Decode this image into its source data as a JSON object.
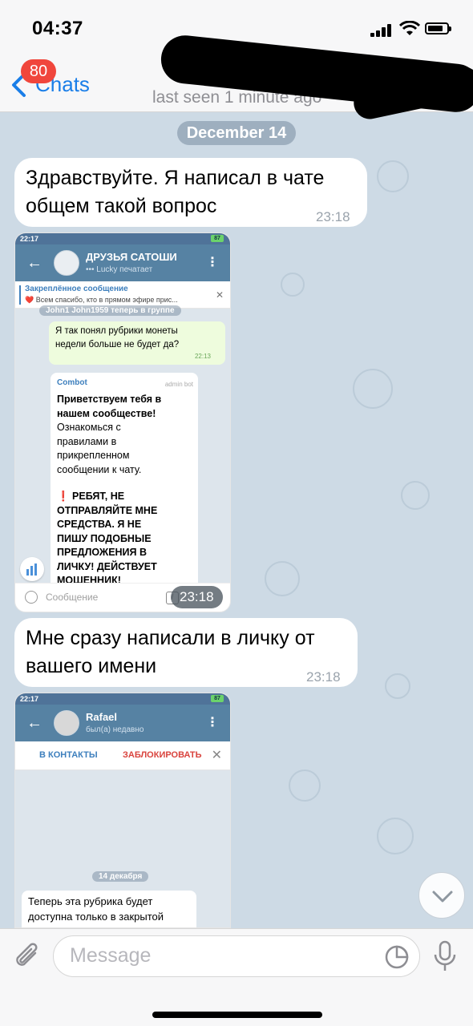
{
  "status_bar": {
    "time": "04:37",
    "battery": "battery-icon",
    "signal": "signal-icon",
    "wifi": "wifi-icon"
  },
  "header": {
    "back_label": "Chats",
    "unread_count": "80",
    "last_seen": "last seen 1 minute ago"
  },
  "date_pill": "December 14",
  "messages": [
    {
      "text_line1": "Здравствуйте.  Я написал в чате",
      "text_line2": "общем  такой  вопрос",
      "time": "23:18"
    },
    {
      "text_line1": "Мне сразу написали в личку от",
      "text_line2": "вашего  имени",
      "time": "23:18"
    }
  ],
  "screenshot1": {
    "status_time": "22:17",
    "battery": "87",
    "group_title": "ДРУЗЬЯ САТОШИ",
    "group_status": "Lucky печатает",
    "pinned_title": "Закреплённое сообщение",
    "pinned_text": "Всем спасибо, кто в прямом эфире прис...",
    "system_msg": "John1 John1959 теперь в группе",
    "question_line1": "Я так понял рубрики монеты",
    "question_line2": "недели больше не будет  да?",
    "question_time": "22:13",
    "bot_name": "Combot",
    "bot_role": "admin bot",
    "bot_lines_bold": [
      "Приветствуем тебя в",
      "нашем сообществе!"
    ],
    "bot_lines": [
      "Ознакомься с",
      "правилами в",
      "прикрепленном",
      "сообщении к чату."
    ],
    "bot_warning": [
      "❗ РЕБЯТ, НЕ",
      "ОТПРАВЛЯЙТЕ МНЕ",
      "СРЕДСТВА. Я НЕ",
      "ПИШУ ПОДОБНЫЕ",
      "ПРЕДЛОЖЕНИЯ В",
      "ЛИЧКУ! ДЕЙСТВУЕТ",
      "МОШЕННИК!"
    ],
    "input_placeholder": "Сообщение",
    "time_overlay": "23:18"
  },
  "screenshot2": {
    "status_time": "22:17",
    "contact_name": "Rafael",
    "contact_status": "был(а) недавно",
    "add_contact": "В КОНТАКТЫ",
    "block": "ЗАБЛОКИРОВАТЬ",
    "date_pill": "14 декабря",
    "msg_line1": "Теперь эта рубрика будет",
    "msg_line2": "доступна только в закрытой"
  },
  "input_bar": {
    "placeholder": "Message"
  },
  "colors": {
    "accent": "#1a7ee8",
    "badge": "#f0463c",
    "telegram_toolbar": "#5682a3"
  }
}
